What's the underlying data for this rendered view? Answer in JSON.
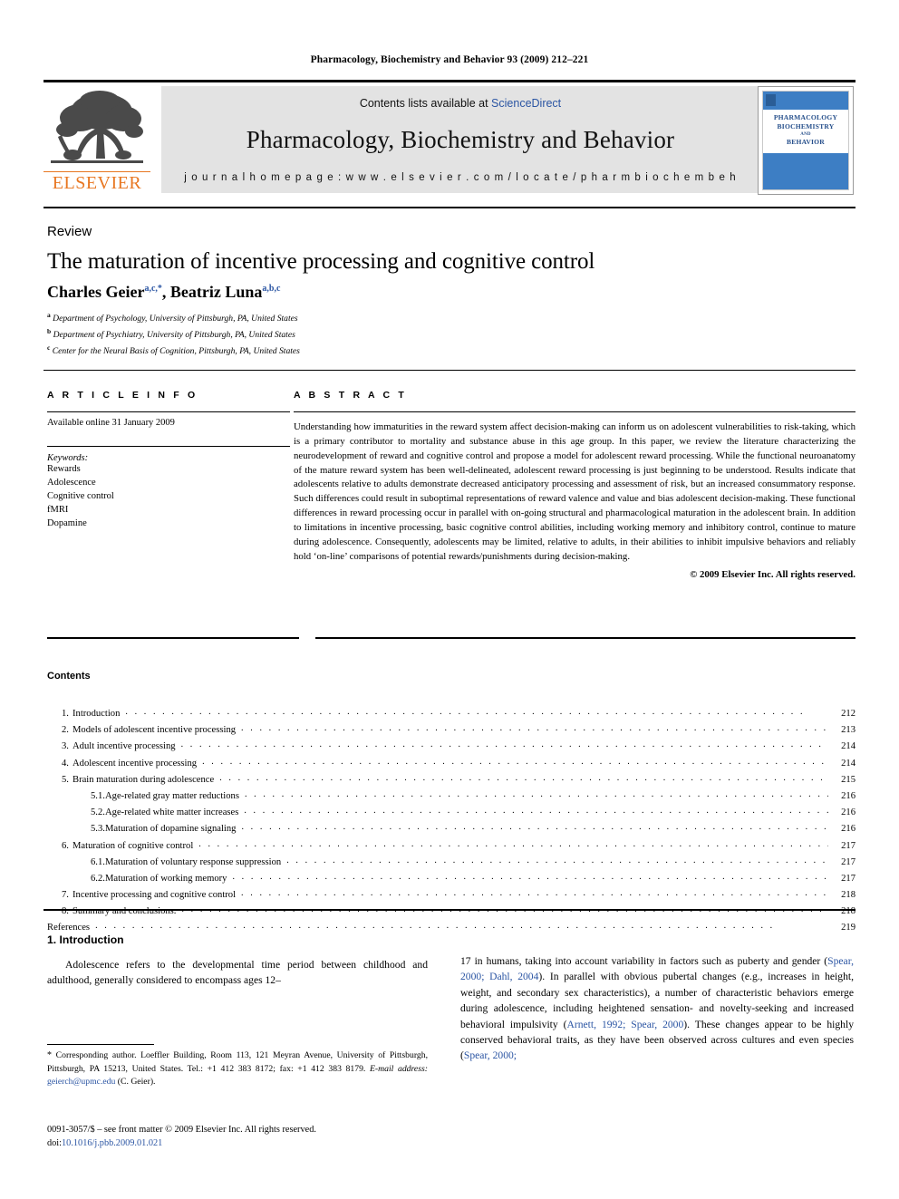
{
  "running_head": "Pharmacology, Biochemistry and Behavior 93 (2009) 212–221",
  "masthead": {
    "contents_available": "Contents lists available at",
    "sciencedirect": "ScienceDirect",
    "journal_title": "Pharmacology, Biochemistry and Behavior",
    "homepage": "j o u r n a l   h o m e p a g e :   w w w . e l s e v i e r . c o m / l o c a t e / p h a r m b i o c h e m b e h",
    "publisher_name": "ELSEVIER",
    "cover": {
      "line1": "PHARMACOLOGY",
      "line2": "BIOCHEMISTRY",
      "line3": "AND",
      "line4": "BEHAVIOR"
    }
  },
  "article": {
    "doctype": "Review",
    "title": "The maturation of incentive processing and cognitive control",
    "author1_name": "Charles Geier",
    "author1_sup": "a,c,*",
    "author_sep": ", ",
    "author2_name": "Beatriz Luna",
    "author2_sup": "a,b,c",
    "affiliations": [
      {
        "mark": "a",
        "text": "Department of Psychology, University of Pittsburgh, PA, United States"
      },
      {
        "mark": "b",
        "text": "Department of Psychiatry, University of Pittsburgh, PA, United States"
      },
      {
        "mark": "c",
        "text": "Center for the Neural Basis of Cognition, Pittsburgh, PA, United States"
      }
    ]
  },
  "article_info": {
    "heading": "A R T I C L E   I N F O",
    "history": "Available online 31 January 2009",
    "keywords_label": "Keywords:",
    "keywords": [
      "Rewards",
      "Adolescence",
      "Cognitive control",
      "fMRI",
      "Dopamine"
    ]
  },
  "abstract": {
    "heading": "A B S T R A C T",
    "text": "Understanding how immaturities in the reward system affect decision-making can inform us on adolescent vulnerabilities to risk-taking, which is a primary contributor to mortality and substance abuse in this age group. In this paper, we review the literature characterizing the neurodevelopment of reward and cognitive control and propose a model for adolescent reward processing. While the functional neuroanatomy of the mature reward system has been well-delineated, adolescent reward processing is just beginning to be understood. Results indicate that adolescents relative to adults demonstrate decreased anticipatory processing and assessment of risk, but an increased consummatory response. Such differences could result in suboptimal representations of reward valence and value and bias adolescent decision-making. These functional differences in reward processing occur in parallel with on-going structural and pharmacological maturation in the adolescent brain. In addition to limitations in incentive processing, basic cognitive control abilities, including working memory and inhibitory control, continue to mature during adolescence. Consequently, adolescents may be limited, relative to adults, in their abilities to inhibit impulsive behaviors and reliably hold ‘on-line’ comparisons of potential rewards/punishments during decision-making.",
    "copyright": "© 2009 Elsevier Inc. All rights reserved."
  },
  "contents": {
    "heading": "Contents",
    "entries": [
      {
        "num": "1.",
        "label": "Introduction",
        "page": "212",
        "level": 1
      },
      {
        "num": "2.",
        "label": "Models of adolescent incentive processing",
        "page": "213",
        "level": 1
      },
      {
        "num": "3.",
        "label": "Adult incentive processing",
        "page": "214",
        "level": 1
      },
      {
        "num": "4.",
        "label": "Adolescent incentive processing",
        "page": "214",
        "level": 1
      },
      {
        "num": "5.",
        "label": "Brain maturation during adolescence",
        "page": "215",
        "level": 1
      },
      {
        "num": "5.1.",
        "label": "Age-related gray matter reductions",
        "page": "216",
        "level": 2
      },
      {
        "num": "5.2.",
        "label": "Age-related white matter increases",
        "page": "216",
        "level": 2
      },
      {
        "num": "5.3.",
        "label": "Maturation of dopamine signaling",
        "page": "216",
        "level": 2
      },
      {
        "num": "6.",
        "label": "Maturation of cognitive control",
        "page": "217",
        "level": 1
      },
      {
        "num": "6.1.",
        "label": "Maturation of voluntary response suppression",
        "page": "217",
        "level": 2
      },
      {
        "num": "6.2.",
        "label": "Maturation of working memory",
        "page": "217",
        "level": 2
      },
      {
        "num": "7.",
        "label": "Incentive processing and cognitive control",
        "page": "218",
        "level": 1
      },
      {
        "num": "8.",
        "label": "Summary and conclusions.",
        "page": "218",
        "level": 1
      },
      {
        "num": "",
        "label": "References",
        "page": "219",
        "level": 0
      }
    ]
  },
  "body": {
    "section_title": "1. Introduction",
    "left_para": "Adolescence refers to the developmental time period between childhood and adulthood, generally considered to encompass ages 12–",
    "right_para_1": "17 in humans, taking into account variability in factors such as puberty and gender (",
    "right_cite_1": "Spear, 2000; Dahl, 2004",
    "right_para_2": "). In parallel with obvious pubertal changes (e.g., increases in height, weight, and secondary sex characteristics), a number of characteristic behaviors emerge during adolescence, including heightened sensation- and novelty-seeking and increased behavioral impulsivity (",
    "right_cite_2": "Arnett, 1992; Spear, 2000",
    "right_para_3": "). These changes appear to be highly conserved behavioral traits, as they have been observed across cultures and even species (",
    "right_cite_3": "Spear, 2000;"
  },
  "footnote": {
    "star": "*",
    "corresponding": " Corresponding author. Loeffler Building, Room 113, 121 Meyran Avenue, University of Pittsburgh, Pittsburgh, PA 15213, United States. Tel.: +1 412 383 8172; fax: +1 412 383 8179.",
    "email_label": "E-mail address:",
    "email": "geierch@upmc.edu",
    "email_suffix": " (C. Geier)."
  },
  "imprint": {
    "front_matter": "0091-3057/$ – see front matter © 2009 Elsevier Inc. All rights reserved.",
    "doi_label": "doi:",
    "doi": "10.1016/j.pbb.2009.01.021"
  },
  "colors": {
    "link": "#2b55a3",
    "elsevier_orange": "#E87722",
    "cover_blue": "#3d7ec4",
    "band_gray": "#e3e3e3"
  }
}
